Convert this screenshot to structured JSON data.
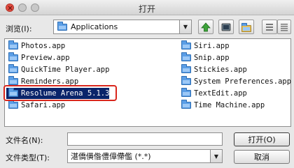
{
  "window": {
    "title": "打开"
  },
  "lookin": {
    "label": "浏览(I):",
    "value": "Applications"
  },
  "files": {
    "left": [
      "Photos.app",
      "Preview.app",
      "QuickTime Player.app",
      "Reminders.app",
      "Resolume Arena 5.1.3",
      "Safari.app"
    ],
    "right": [
      "Siri.app",
      "Snip.app",
      "Stickies.app",
      "System Preferences.app",
      "TextEdit.app",
      "Time Machine.app"
    ],
    "selected": "Resolume Arena 5.1.3"
  },
  "filename": {
    "label": "文件名(N):",
    "value": ""
  },
  "filetype": {
    "label": "文件类型(T):",
    "value": "湛僑僙偺僼傽僀儖 (*.*)"
  },
  "buttons": {
    "open": "打开(O)",
    "cancel": "取消"
  },
  "colors": {
    "selection": "#0a246a",
    "highlight": "#d9261c",
    "folder": "#5b9ee6",
    "up_arrow": "#3da33a"
  }
}
